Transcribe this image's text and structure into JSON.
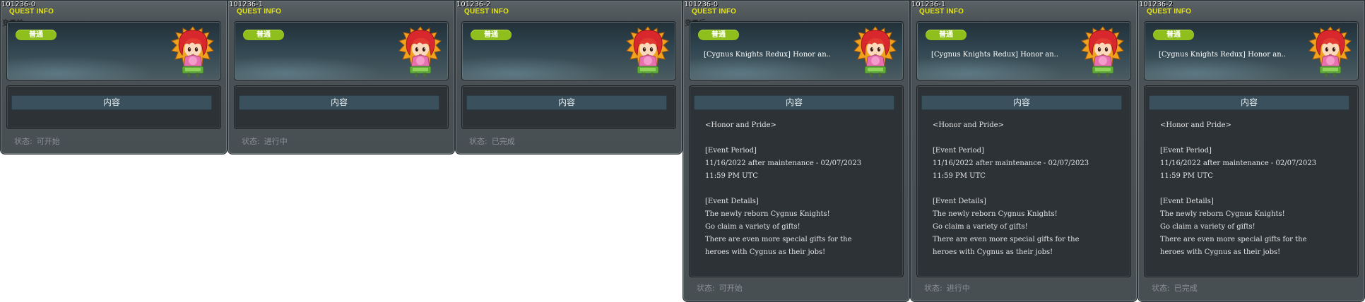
{
  "windows": [
    {
      "id": "101236-0",
      "title": "QUEST INFO",
      "note": "变更前",
      "badge": "普通",
      "quest_name": "",
      "tab": "内容",
      "body": "",
      "status_label": "状态:",
      "status_value": "可开始"
    },
    {
      "id": "101236-1",
      "title": "QUEST INFO",
      "note": "",
      "badge": "普通",
      "quest_name": "",
      "tab": "内容",
      "body": "",
      "status_label": "状态:",
      "status_value": "进行中"
    },
    {
      "id": "101236-2",
      "title": "QUEST INFO",
      "note": "",
      "badge": "普通",
      "quest_name": "",
      "tab": "内容",
      "body": "",
      "status_label": "状态:",
      "status_value": "已完成"
    },
    {
      "id": "101236-0",
      "title": "QUEST INFO",
      "note": "变更后",
      "badge": "普通",
      "quest_name": "[Cygnus Knights Redux] Honor an..",
      "tab": "内容",
      "body": "<Honor and Pride>\n\n[Event Period]\n11/16/2022 after maintenance - 02/07/2023\n11:59 PM UTC\n\n[Event Details]\nThe newly reborn Cygnus Knights!\nGo claim a variety of gifts!\nThere are even more special gifts for the\nheroes with Cygnus as their jobs!",
      "status_label": "状态:",
      "status_value": "可开始"
    },
    {
      "id": "101236-1",
      "title": "QUEST INFO",
      "note": "",
      "badge": "普通",
      "quest_name": "[Cygnus Knights Redux] Honor an..",
      "tab": "内容",
      "body": "<Honor and Pride>\n\n[Event Period]\n11/16/2022 after maintenance - 02/07/2023\n11:59 PM UTC\n\n[Event Details]\nThe newly reborn Cygnus Knights!\nGo claim a variety of gifts!\nThere are even more special gifts for the\nheroes with Cygnus as their jobs!",
      "status_label": "状态:",
      "status_value": "进行中"
    },
    {
      "id": "101236-2",
      "title": "QUEST INFO",
      "note": "",
      "badge": "普通",
      "quest_name": "[Cygnus Knights Redux] Honor an..",
      "tab": "内容",
      "body": "<Honor and Pride>\n\n[Event Period]\n11/16/2022 after maintenance - 02/07/2023\n11:59 PM UTC\n\n[Event Details]\nThe newly reborn Cygnus Knights!\nGo claim a variety of gifts!\nThere are even more special gifts for the\nheroes with Cygnus as their jobs!",
      "status_label": "状态:",
      "status_value": "已完成"
    }
  ],
  "colors": {
    "title": "#e6e60f",
    "badge": "#8fbf1d",
    "status_text": "#8b9196"
  },
  "icons": {
    "npc": "npc-portrait-icon"
  }
}
